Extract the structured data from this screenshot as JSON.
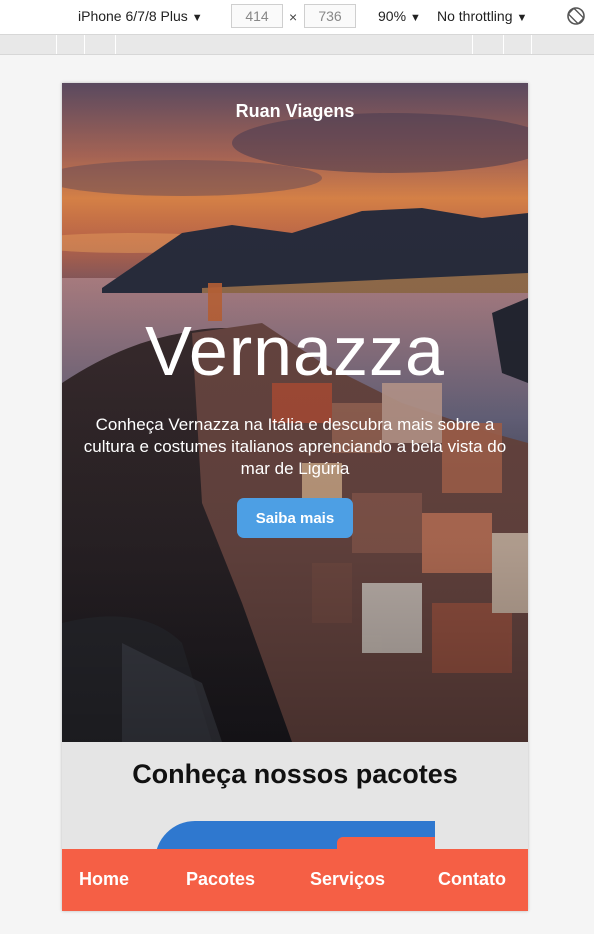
{
  "devtools": {
    "device": "iPhone 6/7/8 Plus",
    "width": "414",
    "height": "736",
    "times": "×",
    "zoom": "90%",
    "throttling": "No throttling"
  },
  "site": {
    "brand": "Ruan Viagens",
    "hero": {
      "title": "Vernazza",
      "description": "Conheça Vernazza na Itália e descubra mais sobre a cultura e costumes italianos aprenciando a bela vista do mar de Ligúria",
      "cta": "Saiba mais"
    },
    "packages": {
      "title": "Conheça nossos pacotes"
    },
    "nav": {
      "items": [
        "Home",
        "Pacotes",
        "Serviços",
        "Contato"
      ]
    }
  },
  "colors": {
    "accent": "#f55f45",
    "button": "#4d9fe4"
  }
}
